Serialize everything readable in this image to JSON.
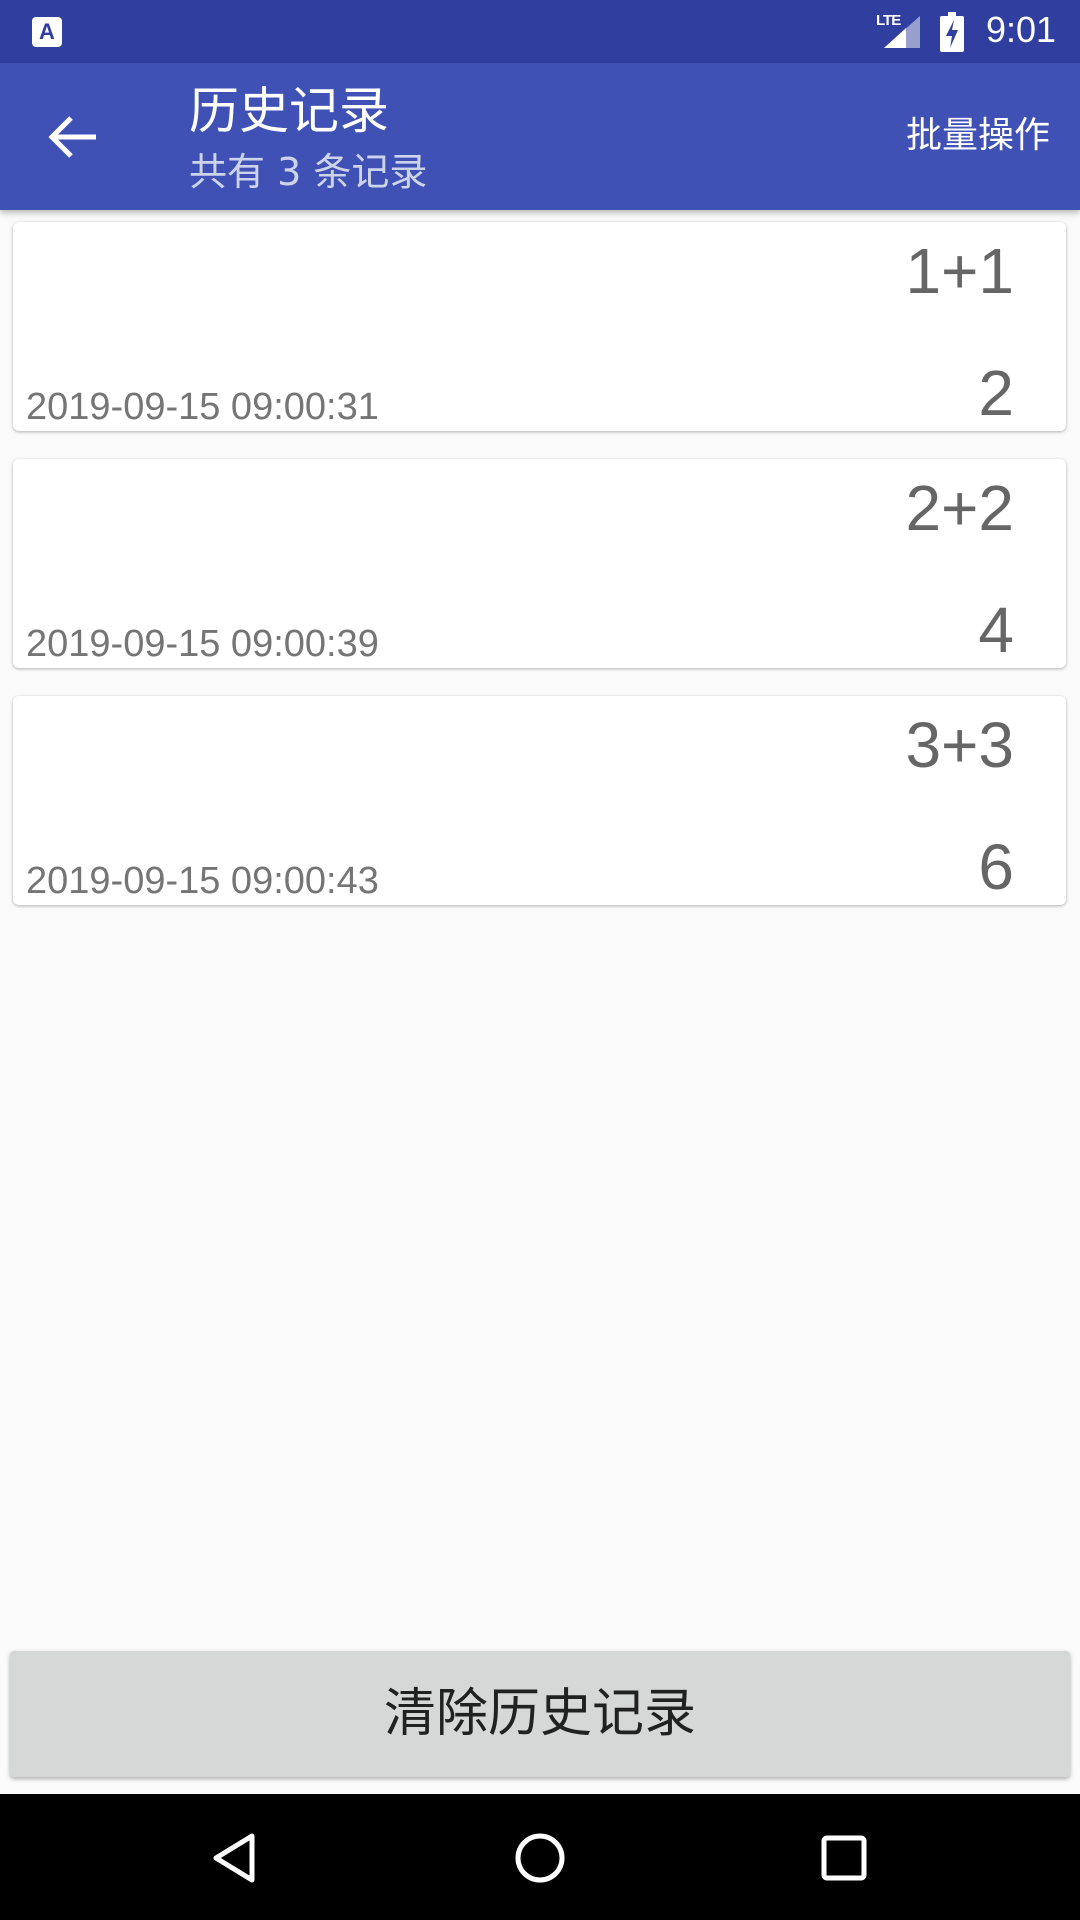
{
  "status_bar": {
    "app_icon_letter": "A",
    "network_label": "LTE",
    "time": "9:01"
  },
  "app_bar": {
    "title": "历史记录",
    "subtitle": "共有 3 条记录",
    "action_label": "批量操作",
    "back_icon": "arrow-left-icon"
  },
  "history": {
    "items": [
      {
        "expression": "1+1",
        "result": "2",
        "timestamp": "2019-09-15 09:00:31"
      },
      {
        "expression": "2+2",
        "result": "4",
        "timestamp": "2019-09-15 09:00:39"
      },
      {
        "expression": "3+3",
        "result": "6",
        "timestamp": "2019-09-15 09:00:43"
      }
    ]
  },
  "clear_button": {
    "label": "清除历史记录"
  },
  "nav_bar": {
    "icons": [
      "back-triangle-icon",
      "home-circle-icon",
      "recents-square-icon"
    ]
  },
  "colors": {
    "status_bar": "#303f9f",
    "app_bar": "#3f51b5",
    "background": "#fafafa",
    "button": "#d6d7d7"
  }
}
